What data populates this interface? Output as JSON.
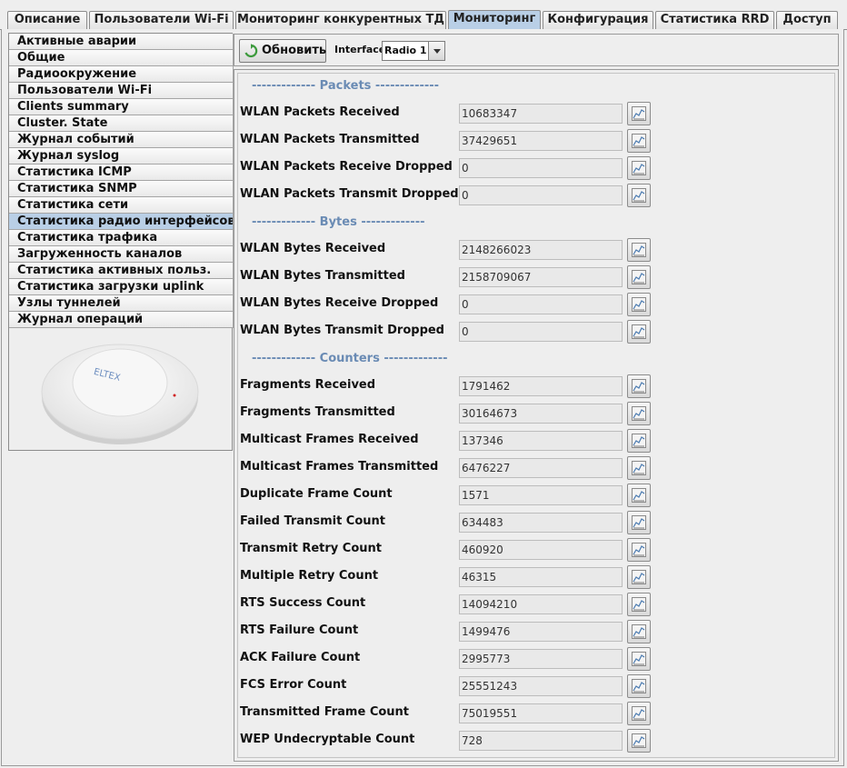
{
  "tabs": [
    {
      "label": "Описание",
      "active": false
    },
    {
      "label": "Пользователи Wi-Fi",
      "active": false
    },
    {
      "label": "Мониторинг конкурентных ТД",
      "active": false
    },
    {
      "label": "Мониторинг",
      "active": true
    },
    {
      "label": "Конфигурация",
      "active": false
    },
    {
      "label": "Статистика RRD",
      "active": false
    },
    {
      "label": "Доступ",
      "active": false
    }
  ],
  "sidebar": {
    "items": [
      {
        "label": "Активные аварии"
      },
      {
        "label": "Общие"
      },
      {
        "label": "Радиоокружение"
      },
      {
        "label": "Пользователи Wi-Fi"
      },
      {
        "label": "Clients summary"
      },
      {
        "label": "Cluster. State"
      },
      {
        "label": "Журнал событий"
      },
      {
        "label": "Журнал syslog"
      },
      {
        "label": "Статистика ICMP"
      },
      {
        "label": "Статистика SNMP"
      },
      {
        "label": "Статистика сети"
      },
      {
        "label": "Статистика радио интерфейсов",
        "selected": true
      },
      {
        "label": "Статистика трафика"
      },
      {
        "label": "Загруженность каналов"
      },
      {
        "label": "Статистика активных польз."
      },
      {
        "label": "Статистика загрузки uplink"
      },
      {
        "label": "Узлы туннелей"
      },
      {
        "label": "Журнал операций"
      }
    ],
    "device_logo": "ELTEX"
  },
  "toolbar": {
    "refresh_label": "Обновить",
    "refresh_icon": "refresh-icon",
    "interface_label": "Interface",
    "interface_value": "Radio 1"
  },
  "sections": [
    {
      "title": "------------- Packets -------------",
      "rows": [
        {
          "label": "WLAN Packets Received",
          "value": "10683347"
        },
        {
          "label": "WLAN Packets Transmitted",
          "value": "37429651"
        },
        {
          "label": "WLAN Packets Receive Dropped",
          "value": "0"
        },
        {
          "label": "WLAN Packets Transmit Dropped",
          "value": "0"
        }
      ]
    },
    {
      "title": "------------- Bytes -------------",
      "rows": [
        {
          "label": "WLAN Bytes Received",
          "value": "2148266023"
        },
        {
          "label": "WLAN Bytes Transmitted",
          "value": "2158709067"
        },
        {
          "label": "WLAN Bytes Receive Dropped",
          "value": "0"
        },
        {
          "label": "WLAN Bytes Transmit Dropped",
          "value": "0"
        }
      ]
    },
    {
      "title": "------------- Counters -------------",
      "rows": [
        {
          "label": "Fragments Received",
          "value": "1791462"
        },
        {
          "label": "Fragments Transmitted",
          "value": "30164673"
        },
        {
          "label": "Multicast Frames Received",
          "value": "137346"
        },
        {
          "label": "Multicast Frames Transmitted",
          "value": "6476227"
        },
        {
          "label": "Duplicate Frame Count",
          "value": "1571"
        },
        {
          "label": "Failed Transmit Count",
          "value": "634483"
        },
        {
          "label": "Transmit Retry Count",
          "value": "460920"
        },
        {
          "label": "Multiple Retry Count",
          "value": "46315"
        },
        {
          "label": "RTS Success Count",
          "value": "14094210"
        },
        {
          "label": "RTS Failure Count",
          "value": "1499476"
        },
        {
          "label": "ACK Failure Count",
          "value": "2995773"
        },
        {
          "label": "FCS Error Count",
          "value": "25551243"
        },
        {
          "label": "Transmitted Frame Count",
          "value": "75019551"
        },
        {
          "label": "WEP Undecryptable Count",
          "value": "728"
        }
      ]
    }
  ],
  "row_button_icon": "chart-icon",
  "colors": {
    "selected_bg": "#b9cfe6",
    "section_title": "#6a8bb4",
    "panel_bg": "#eeeeee"
  }
}
